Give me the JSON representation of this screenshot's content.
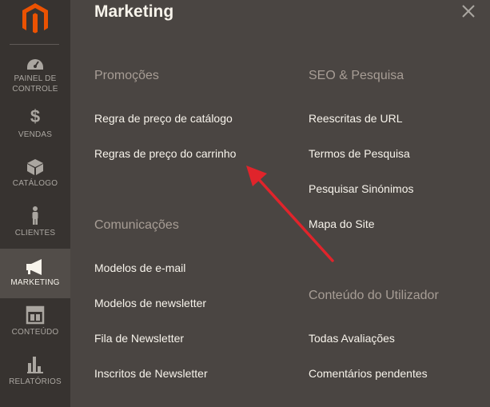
{
  "sidebar": {
    "logo": "magento-logo",
    "items": [
      {
        "label": "PAINEL DE CONTROLE",
        "icon": "dashboard-icon"
      },
      {
        "label": "VENDAS",
        "icon": "dollar-icon"
      },
      {
        "label": "CATÁLOGO",
        "icon": "box-icon"
      },
      {
        "label": "CLIENTES",
        "icon": "person-icon"
      },
      {
        "label": "MARKETING",
        "icon": "megaphone-icon"
      },
      {
        "label": "CONTEÚDO",
        "icon": "layout-icon"
      },
      {
        "label": "RELATÓRIOS",
        "icon": "bar-chart-icon"
      }
    ],
    "active_item": "MARKETING"
  },
  "panel": {
    "title": "Marketing",
    "close_icon": "close-icon",
    "promocoes": {
      "title": "Promoções",
      "links": [
        "Regra de preço de catálogo",
        "Regras de preço do carrinho"
      ]
    },
    "comunicacoes": {
      "title": "Comunicações",
      "links": [
        "Modelos de e-mail",
        "Modelos de newsletter",
        "Fila de Newsletter",
        "Inscritos de Newsletter"
      ]
    },
    "seo": {
      "title": "SEO & Pesquisa",
      "links": [
        "Reescritas de URL",
        "Termos de Pesquisa",
        "Pesquisar Sinónimos",
        "Mapa do Site"
      ]
    },
    "conteudo": {
      "title": "Conteúdo do Utilizador",
      "links": [
        "Todas Avaliações",
        "Comentários pendentes"
      ]
    }
  },
  "annotation": {
    "arrow_color": "#e0242b",
    "points_to": "Regras de preço do carrinho"
  },
  "colors": {
    "sidebar_bg": "#373330",
    "panel_bg": "#4a4542",
    "brand_orange": "#eb5202"
  }
}
